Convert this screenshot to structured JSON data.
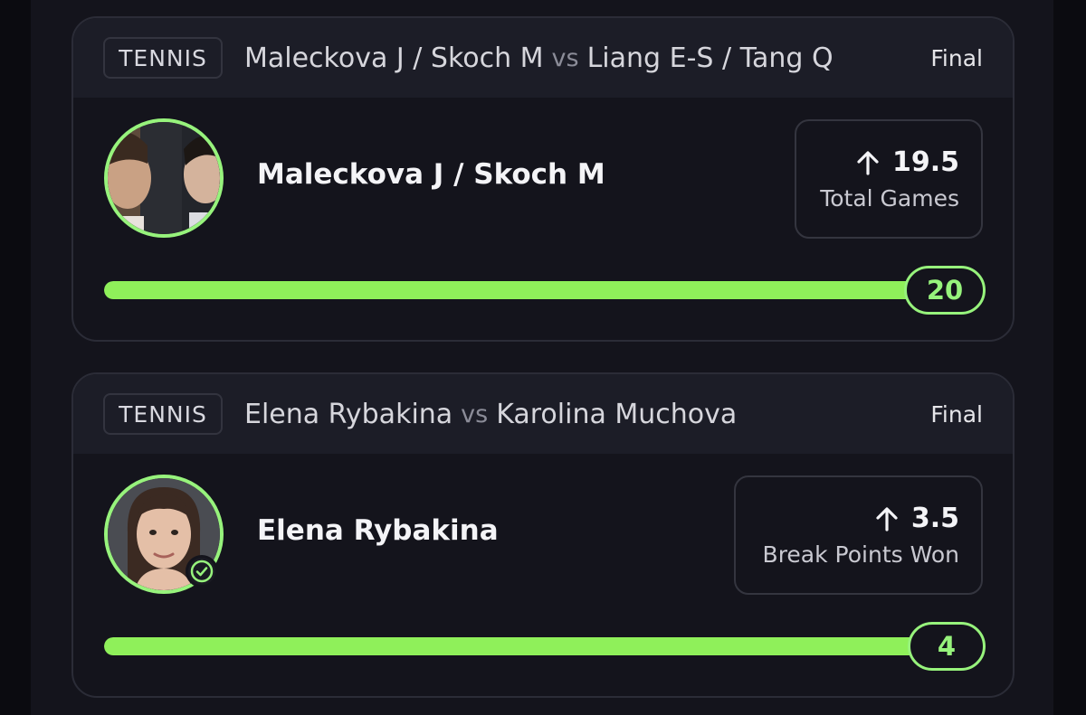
{
  "colors": {
    "accent": "#97f37c",
    "progress": "#8ff05a",
    "card_bg": "#14141c",
    "header_bg": "#1c1d27",
    "page_bg": "#0b0b10"
  },
  "cards": [
    {
      "sport": "TENNIS",
      "team_a": "Maleckova J / Skoch M",
      "vs": "vs",
      "team_b": "Liang E-S / Tang Q",
      "status": "Final",
      "player": "Maleckova J / Skoch M",
      "avatar_icon": "doubles-team-photo",
      "stat_direction_icon": "arrow-up-icon",
      "line": "19.5",
      "stat_label": "Total Games",
      "result": "20",
      "progress_fraction": 1.0
    },
    {
      "sport": "TENNIS",
      "team_a": "Elena Rybakina",
      "vs": "vs",
      "team_b": "Karolina Muchova",
      "status": "Final",
      "player": "Elena Rybakina",
      "avatar_icon": "player-photo",
      "verified_icon": "check-circle-icon",
      "stat_direction_icon": "arrow-up-icon",
      "line": "3.5",
      "stat_label": "Break Points Won",
      "result": "4",
      "progress_fraction": 1.0
    }
  ]
}
